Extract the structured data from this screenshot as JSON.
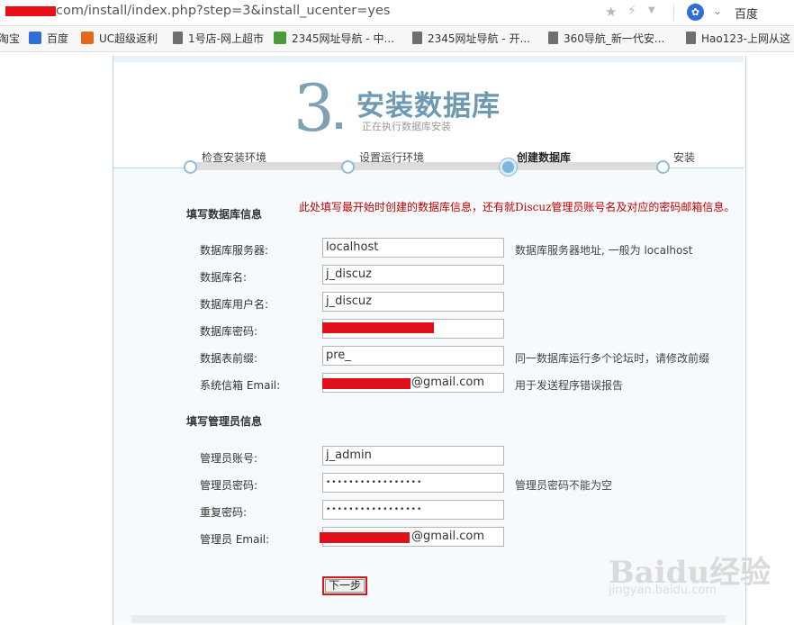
{
  "browser": {
    "url": "com/install/index.php?step=3&install_ucenter=yes",
    "search_engine": "百度",
    "bookmarks": [
      "淘宝",
      "百度",
      "UC超级返利",
      "1号店-网上超市",
      "2345网址导航 - 中...",
      "2345网址导航 - 开...",
      "360导航_新一代安...",
      "Hao123-上网从这"
    ]
  },
  "header": {
    "step_number": "3",
    "title": "安装数据库",
    "subtitle": "正在执行数据库安装"
  },
  "progress": {
    "steps": [
      "检查安装环境",
      "设置运行环境",
      "创建数据库",
      "安装"
    ],
    "current_index": 2
  },
  "db_section": {
    "title": "填写数据库信息",
    "notice": "此处填写最开始时创建的数据库信息，还有就Discuz管理员账号名及对应的密码邮箱信息。",
    "fields": [
      {
        "label": "数据库服务器:",
        "value": "localhost",
        "hint": "数据库服务器地址, 一般为 localhost"
      },
      {
        "label": "数据库名:",
        "value": "j_discuz",
        "hint": ""
      },
      {
        "label": "数据库用户名:",
        "value": "j_discuz",
        "hint": ""
      },
      {
        "label": "数据库密码:",
        "value": "",
        "hint": ""
      },
      {
        "label": "数据表前缀:",
        "value": "pre_",
        "hint": "同一数据库运行多个论坛时，请修改前缀"
      },
      {
        "label": "系统信箱 Email:",
        "value": "@gmail.com",
        "hint": "用于发送程序错误报告"
      }
    ]
  },
  "admin_section": {
    "title": "填写管理员信息",
    "fields": [
      {
        "label": "管理员账号:",
        "value": "j_admin",
        "hint": ""
      },
      {
        "label": "管理员密码:",
        "value": "•••••••••••••••••",
        "hint": "管理员密码不能为空"
      },
      {
        "label": "重复密码:",
        "value": "•••••••••••••••••",
        "hint": ""
      },
      {
        "label": "管理员 Email:",
        "value": "@gmail.com",
        "hint": ""
      }
    ]
  },
  "next_button": "下一步",
  "watermark": {
    "line1": "Baidu经验",
    "line2": "jingyan.baidu.com"
  },
  "colors": {
    "redaction": "#e0101a",
    "notice": "#c00000",
    "accent": "#6d9ab1"
  }
}
